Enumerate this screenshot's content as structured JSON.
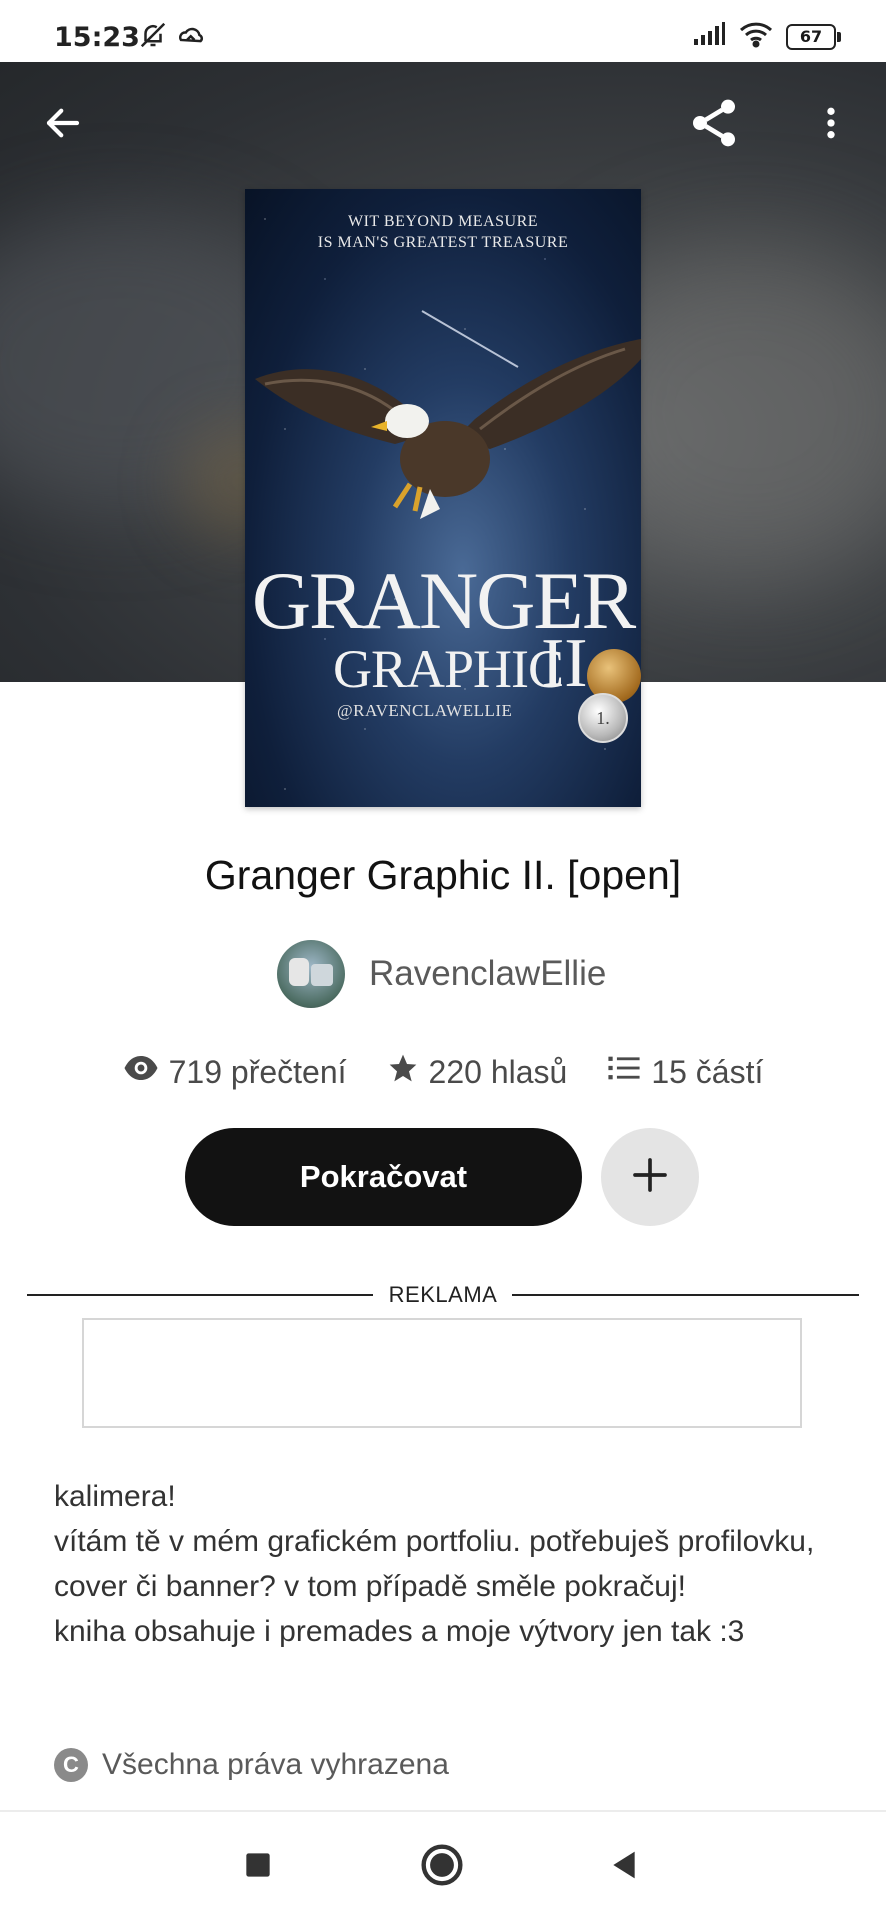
{
  "status_bar": {
    "time": "15:23",
    "battery": "67",
    "icons": [
      "bell-off-icon",
      "cloud-weather-icon",
      "signal-icon",
      "wifi-icon",
      "battery-icon"
    ]
  },
  "header": {
    "back_icon": "arrow-left-icon",
    "share_icon": "share-icon",
    "more_icon": "more-vertical-icon"
  },
  "cover": {
    "quote_line1": "WIT BEYOND MEASURE",
    "quote_line2": "IS MAN'S GREATEST TREASURE",
    "title": "GRANGER",
    "subtitle": "GRAPHIC",
    "numeral": "II",
    "handle": "@RAVENCLAWELLIE",
    "badge_text": "1."
  },
  "book": {
    "title": "Granger Graphic II. [open]",
    "author": "RavenclawEllie"
  },
  "stats": {
    "reads": "719 přečtení",
    "votes": "220 hlasů",
    "parts": "15 částí"
  },
  "actions": {
    "continue_label": "Pokračovat",
    "add_icon": "plus-icon"
  },
  "ad": {
    "label": "REKLAMA"
  },
  "description": {
    "lines": [
      "kalimera!",
      "vítám tě v mém grafickém portfoliu. potřebuješ profilovku, cover či banner? v tom případě směle pokračuj!",
      "kniha obsahuje i premades a moje výtvory jen tak :3"
    ]
  },
  "copyright": {
    "label": "Všechna práva vyhrazena",
    "icon": "copyright-icon"
  },
  "nav_bar": {
    "icons": [
      "square-recents-icon",
      "circle-home-icon",
      "triangle-back-icon"
    ]
  },
  "colors": {
    "primary_button": "#121212",
    "secondary_button": "#e4e4e4",
    "header_bg": "#2f3235"
  }
}
